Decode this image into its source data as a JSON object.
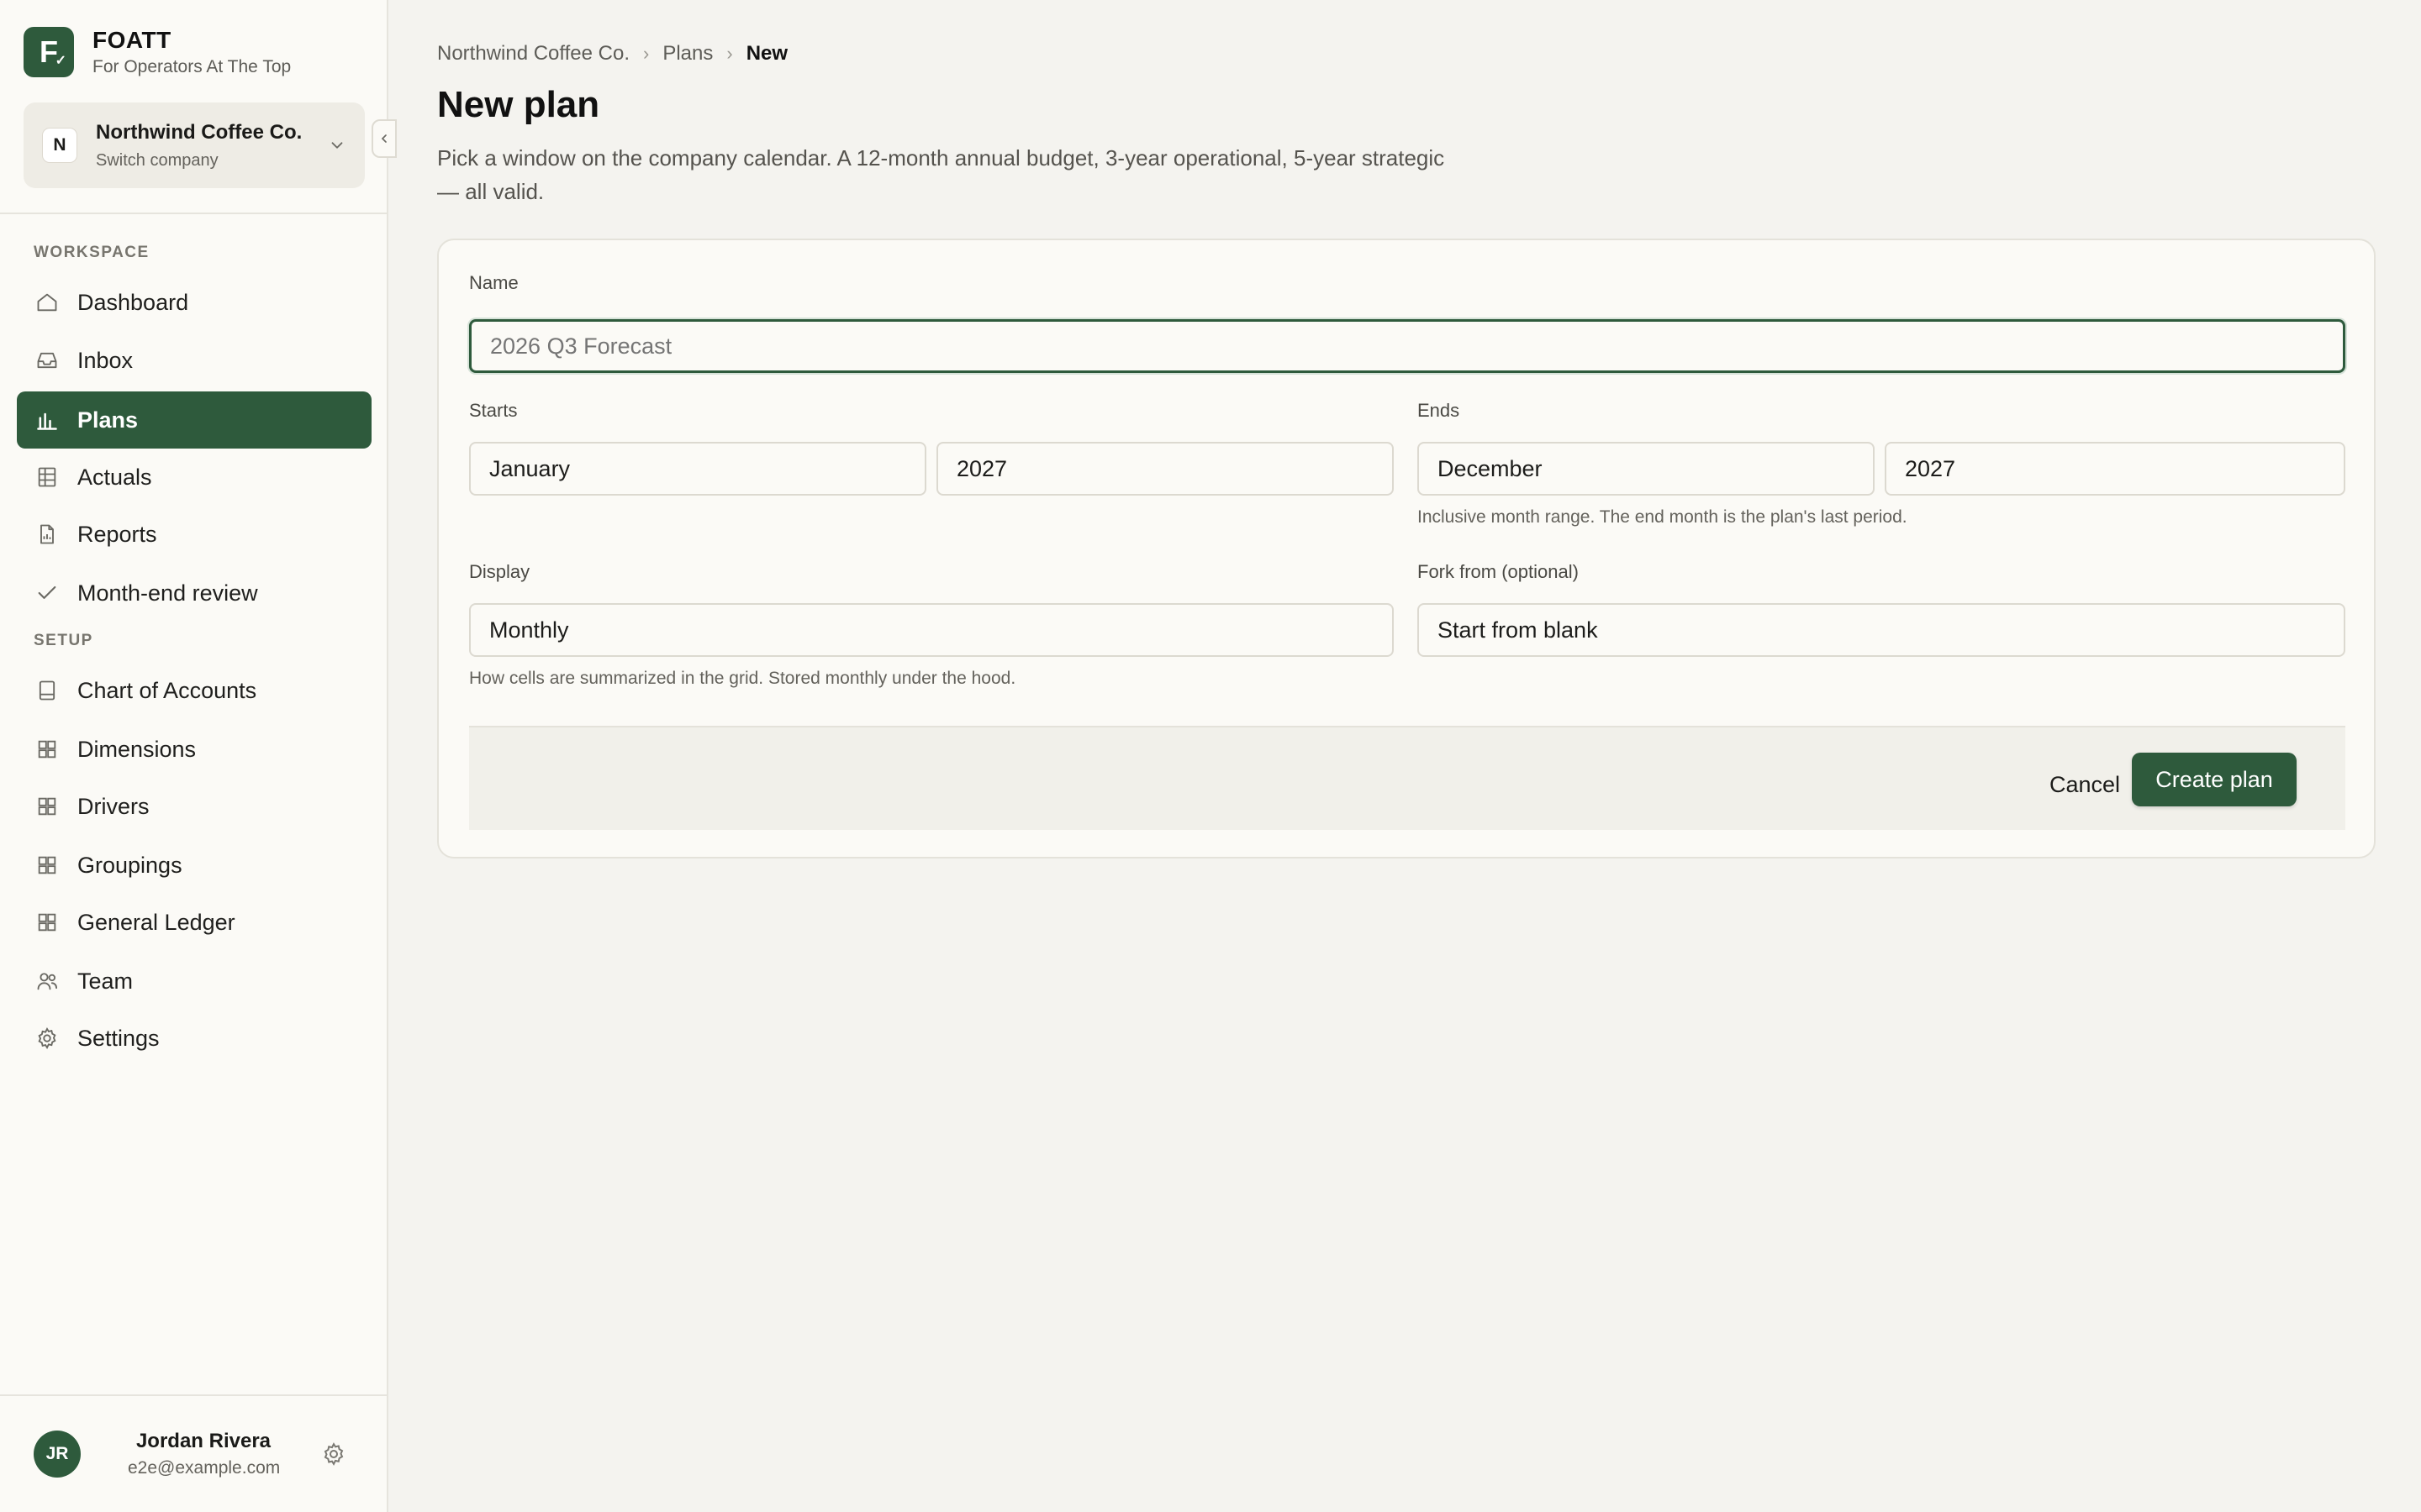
{
  "brand": {
    "logo_letter": "F",
    "logo_mark": "✓",
    "name": "FOATT",
    "tagline": "For Operators At The Top"
  },
  "company": {
    "avatar_letter": "N",
    "name": "Northwind Coffee Co.",
    "subtitle": "Switch company"
  },
  "sidebar": {
    "workspace_label": "WORKSPACE",
    "setup_label": "SETUP",
    "workspace_items": [
      {
        "label": "Dashboard",
        "icon": "home-icon"
      },
      {
        "label": "Inbox",
        "icon": "inbox-icon"
      },
      {
        "label": "Plans",
        "icon": "bar-chart-icon",
        "active": true
      },
      {
        "label": "Actuals",
        "icon": "table-icon"
      },
      {
        "label": "Reports",
        "icon": "report-icon"
      },
      {
        "label": "Month-end review",
        "icon": "check-icon"
      }
    ],
    "setup_items": [
      {
        "label": "Chart of Accounts",
        "icon": "book-icon"
      },
      {
        "label": "Dimensions",
        "icon": "grid-icon"
      },
      {
        "label": "Drivers",
        "icon": "grid-icon"
      },
      {
        "label": "Groupings",
        "icon": "grid-icon"
      },
      {
        "label": "General Ledger",
        "icon": "grid-icon"
      },
      {
        "label": "Team",
        "icon": "users-icon"
      },
      {
        "label": "Settings",
        "icon": "gear-icon"
      }
    ]
  },
  "user": {
    "initials": "JR",
    "name": "Jordan Rivera",
    "email": "e2e@example.com"
  },
  "breadcrumb": {
    "items": [
      "Northwind Coffee Co.",
      "Plans"
    ],
    "current": "New"
  },
  "page": {
    "title": "New plan",
    "description": "Pick a window on the company calendar. A 12-month annual budget, 3-year operational, 5-year strategic — all valid."
  },
  "form": {
    "name_label": "Name",
    "name_placeholder": "2026 Q3 Forecast",
    "name_value": "",
    "starts_label": "Starts",
    "start_month": "January",
    "start_year": "2027",
    "ends_label": "Ends",
    "end_month": "December",
    "end_year": "2027",
    "range_hint": "Inclusive month range. The end month is the plan's last period.",
    "display_label": "Display",
    "display_value": "Monthly",
    "display_hint": "How cells are summarized in the grid. Stored monthly under the hood.",
    "fork_label": "Fork from (optional)",
    "fork_value": "Start from blank",
    "cancel_label": "Cancel",
    "create_label": "Create plan"
  },
  "colors": {
    "accent": "#2e5a3c",
    "background": "#f4f3ef",
    "sidebar": "#fbfaf6"
  }
}
